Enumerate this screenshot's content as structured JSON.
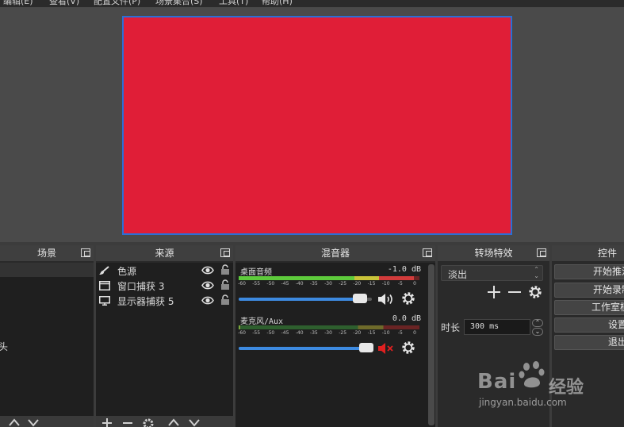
{
  "menu": [
    "编辑(E)",
    "查看(V)",
    "配置文件(P)",
    "场景集合(S)",
    "工具(T)",
    "帮助(H)"
  ],
  "preview": {
    "canvas_color": "#e01e37",
    "border_color": "#2a6fd6"
  },
  "scenes": {
    "title": "场景",
    "partial_item": "头",
    "footer": [
      "^",
      "v"
    ]
  },
  "sources": {
    "title": "来源",
    "items": [
      {
        "icon": "brush-icon",
        "name": "色源"
      },
      {
        "icon": "window-icon",
        "name": "窗口捕获 3"
      },
      {
        "icon": "monitor-icon",
        "name": "显示器捕获 5"
      }
    ],
    "footer": [
      "+",
      "−",
      "⚙",
      "^",
      "v"
    ]
  },
  "mixer": {
    "title": "混音器",
    "ticks": [
      "-60",
      "-55",
      "-50",
      "-45",
      "-40",
      "-35",
      "-30",
      "-25",
      "-20",
      "-15",
      "-10",
      "-5",
      "0"
    ],
    "tracks": [
      {
        "name": "桌面音频",
        "db": "-1.0 dB",
        "meter_level": 0.97,
        "volume": 0.91,
        "muted": false
      },
      {
        "name": "麦克风/Aux",
        "db": "0.0 dB",
        "meter_level": 0.01,
        "volume": 0.96,
        "muted": true
      }
    ]
  },
  "transitions": {
    "title": "转场特效",
    "selected": "淡出",
    "duration_label": "时长",
    "duration_value": "300 ms"
  },
  "controls": {
    "title": "控件",
    "buttons": [
      "开始推流",
      "开始录制",
      "工作室模式",
      "设置",
      "退出"
    ]
  },
  "watermark": {
    "brand": "Bai",
    "brand2": "经验",
    "url": "jingyan.baidu.com"
  },
  "colors": {
    "accent": "#3d8ae0",
    "dock_bg": "#2a2a2a",
    "mute": "#e02020"
  }
}
